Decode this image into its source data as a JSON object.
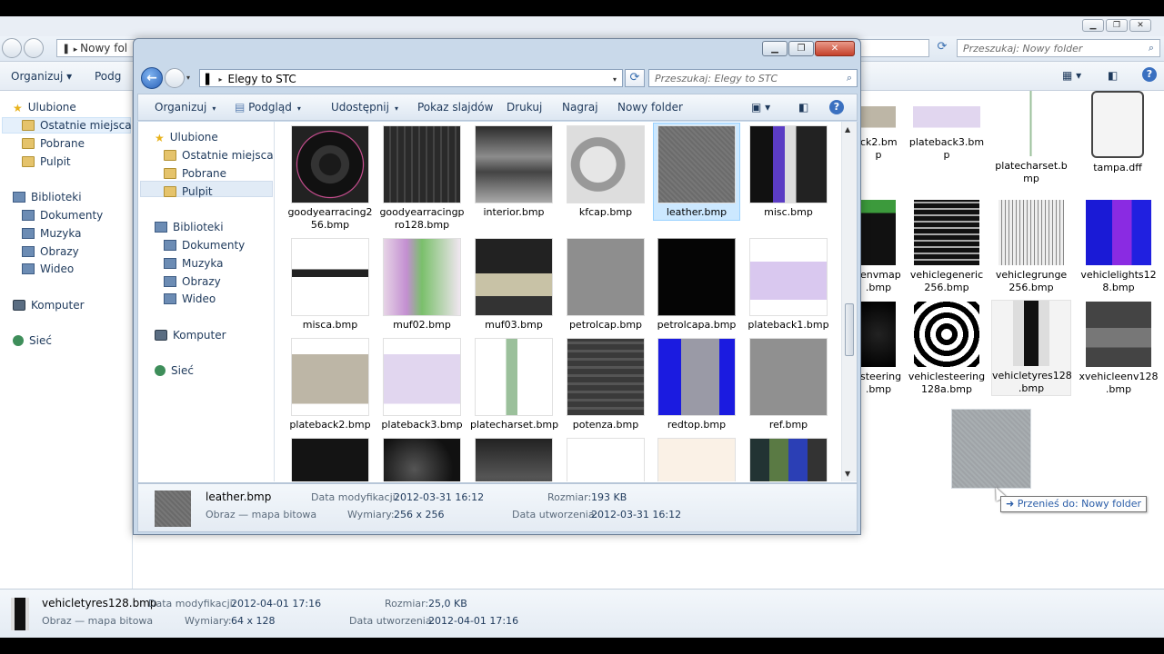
{
  "background_window": {
    "address": "Nowy fol",
    "search_placeholder": "Przeszukaj: Nowy folder",
    "toolbar": {
      "organize": "Organizuj ▾",
      "preview": "Podg"
    },
    "sidebar": [
      "Ulubione",
      "Ostatnie miejsca",
      "Pobrane",
      "Pulpit",
      "Biblioteki",
      "Dokumenty",
      "Muzyka",
      "Obrazy",
      "Wideo",
      "Komputer",
      "Sieć"
    ],
    "files": [
      {
        "label": "ck2.bm\np"
      },
      {
        "label": "plateback3.bm\np"
      },
      {
        "label": "platecharset.b\nmp"
      },
      {
        "label": "tampa.dff"
      },
      {
        "label": "envmap\n.bmp"
      },
      {
        "label": "vehiclegeneric\n256.bmp"
      },
      {
        "label": "vehiclegrunge\n256.bmp"
      },
      {
        "label": "vehiclelights12\n8.bmp"
      },
      {
        "label": "steering\n.bmp"
      },
      {
        "label": "vehiclesteering\n128a.bmp"
      },
      {
        "label": "vehicletyres128\n.bmp"
      },
      {
        "label": "xvehicleenv128\n.bmp"
      }
    ],
    "details": {
      "name": "vehicletyres128.bmp",
      "type": "Obraz — mapa bitowa",
      "modified_label": "Data modyfikacji:",
      "modified": "2012-04-01 17:16",
      "dimensions_label": "Wymiary:",
      "dimensions": "64 x 128",
      "size_label": "Rozmiar:",
      "size": "25,0 KB",
      "created_label": "Data utworzenia:",
      "created": "2012-04-01 17:16"
    }
  },
  "front_window": {
    "address": "Elegy to STC",
    "search_placeholder": "Przeszukaj: Elegy to STC",
    "toolbar": {
      "organize": "Organizuj",
      "preview": "Podgląd",
      "share": "Udostępnij",
      "slideshow": "Pokaz slajdów",
      "print": "Drukuj",
      "burn": "Nagraj",
      "new_folder": "Nowy folder"
    },
    "sidebar": {
      "favorites": "Ulubione",
      "recent": "Ostatnie miejsca",
      "downloads": "Pobrane",
      "desktop": "Pulpit",
      "libraries": "Biblioteki",
      "documents": "Dokumenty",
      "music": "Muzyka",
      "pictures": "Obrazy",
      "videos": "Wideo",
      "computer": "Komputer",
      "network": "Sieć"
    },
    "files": [
      {
        "label": "goodyearracing2\n56.bmp"
      },
      {
        "label": "goodyearracingp\nro128.bmp"
      },
      {
        "label": "interior.bmp"
      },
      {
        "label": "kfcap.bmp"
      },
      {
        "label": "leather.bmp"
      },
      {
        "label": "misc.bmp"
      },
      {
        "label": "misca.bmp"
      },
      {
        "label": "muf02.bmp"
      },
      {
        "label": "muf03.bmp"
      },
      {
        "label": "petrolcap.bmp"
      },
      {
        "label": "petrolcapa.bmp"
      },
      {
        "label": "plateback1.bmp"
      },
      {
        "label": "plateback2.bmp"
      },
      {
        "label": "plateback3.bmp"
      },
      {
        "label": "platecharset.bmp"
      },
      {
        "label": "potenza.bmp"
      },
      {
        "label": "redtop.bmp"
      },
      {
        "label": "ref.bmp"
      }
    ],
    "details": {
      "name": "leather.bmp",
      "type": "Obraz — mapa bitowa",
      "modified_label": "Data modyfikacji:",
      "modified": "2012-03-31 16:12",
      "dimensions_label": "Wymiary:",
      "dimensions": "256 x 256",
      "size_label": "Rozmiar:",
      "size": "193 KB",
      "created_label": "Data utworzenia:",
      "created": "2012-03-31 16:12"
    }
  },
  "drag_tooltip": "➜ Przenieś do: Nowy folder"
}
